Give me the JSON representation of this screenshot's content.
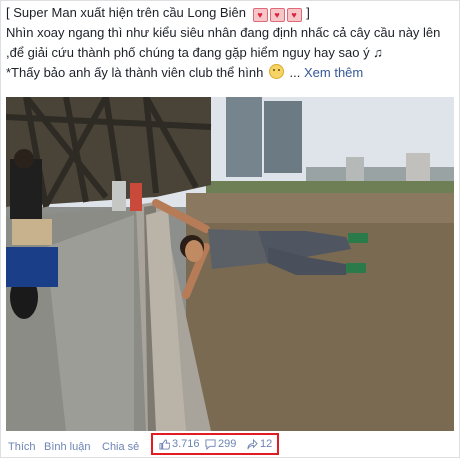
{
  "post": {
    "title_line": "[ Super Man xuất hiện trên cầu Long Biên",
    "title_close": " ]",
    "body_line1": "Nhìn xoay ngang thì như kiểu siêu nhân đang định nhấc cả cây cầu này lên",
    "body_line2": ",để giải cứu thành phố chúng ta đang gặp hiểm nguy hay sao ý ♫",
    "body_line3": "*Thấy bảo anh ấy là thành viên club thể hình",
    "ellipsis": " ...",
    "see_more": "Xem thêm"
  },
  "photo": {
    "alt": "Man doing a human flag pose on the railing of Long Bien bridge above the river"
  },
  "footer": {
    "like_label": "Thích",
    "comment_label": "Bình luận",
    "share_label": "Chia sẻ",
    "likes_count": "3.716",
    "comments_count": "299",
    "shares_count": "12"
  },
  "colors": {
    "link": "#365899",
    "footer_link": "#6d84b4",
    "highlight_border": "#e31b23"
  },
  "icons": [
    "heart-icon",
    "smile-emoji-icon",
    "thumbs-up-icon",
    "comment-bubble-icon",
    "share-arrow-icon"
  ]
}
